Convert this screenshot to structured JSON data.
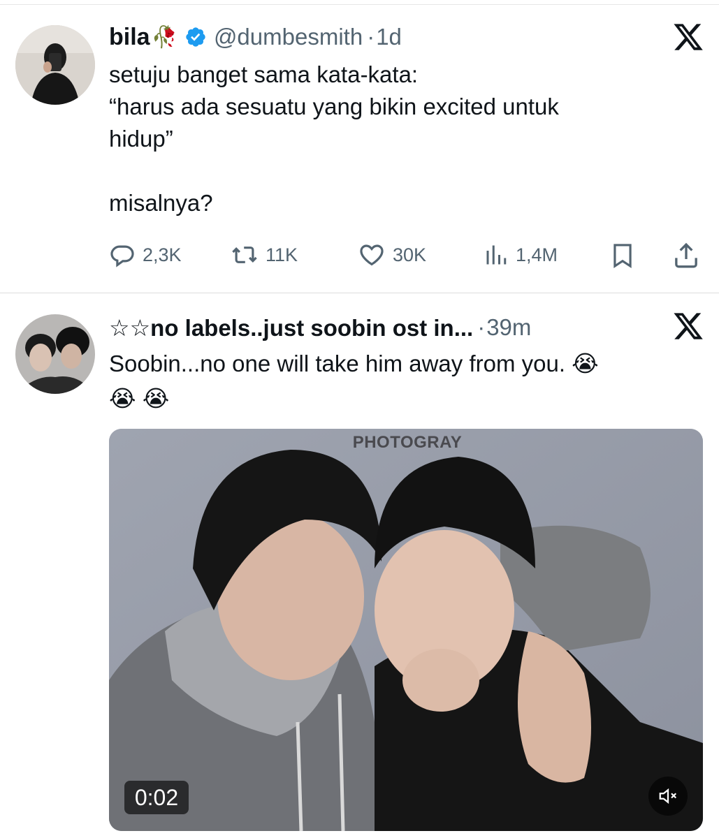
{
  "tweet1": {
    "display_name": "bila",
    "name_emoji": "🥀",
    "handle": "@dumbesmith",
    "separator": "·",
    "time": "1d",
    "text": "setuju banget sama kata-kata:\n“harus ada sesuatu yang bikin excited untuk\nhidup”\n\nmisalnya?",
    "replies": "2,3K",
    "reposts": "11K",
    "likes": "30K",
    "views": "1,4M",
    "icons": [
      "reply-icon",
      "repost-icon",
      "like-icon",
      "views-icon",
      "bookmark-icon",
      "share-icon",
      "x-logo-icon",
      "verified-badge-icon"
    ]
  },
  "tweet2": {
    "display_name": "☆☆no labels..just soobin ost in...",
    "separator": "·",
    "time": "39m",
    "text": "Soobin...no one will take him away from you. 😭\n😭 😭",
    "video": {
      "watermark": "PHOTOGRAY",
      "duration": "0:02",
      "muted": true
    },
    "icons": [
      "x-logo-icon",
      "mute-icon"
    ]
  },
  "colors": {
    "text": "#0f1419",
    "secondary": "#536471",
    "verified": "#1d9bf0"
  }
}
